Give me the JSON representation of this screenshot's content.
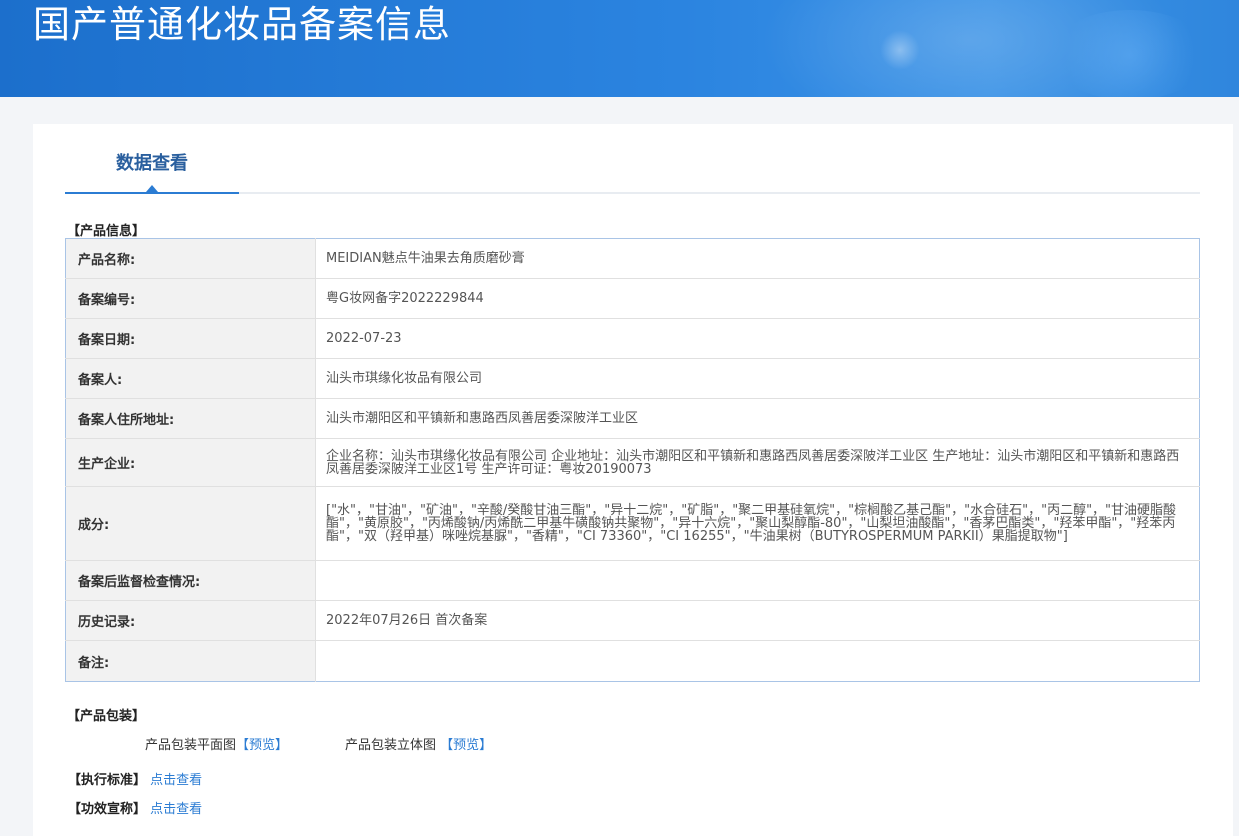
{
  "header": {
    "title": "国产普通化妆品备案信息"
  },
  "tabs": [
    {
      "label": "数据查看"
    }
  ],
  "product_info": {
    "section_title": "【产品信息】",
    "rows": [
      {
        "label": "产品名称:",
        "value": "MEIDIAN魅点牛油果去角质磨砂膏"
      },
      {
        "label": "备案编号:",
        "value": "粤G妆网备字2022229844"
      },
      {
        "label": "备案日期:",
        "value": "2022-07-23"
      },
      {
        "label": "备案人:",
        "value": "汕头市琪缘化妆品有限公司"
      },
      {
        "label": "备案人住所地址:",
        "value": "汕头市潮阳区和平镇新和惠路西凤善居委深陂洋工业区"
      },
      {
        "label": "生产企业:",
        "value": "企业名称：汕头市琪缘化妆品有限公司 企业地址：汕头市潮阳区和平镇新和惠路西凤善居委深陂洋工业区 生产地址：汕头市潮阳区和平镇新和惠路西凤善居委深陂洋工业区1号 生产许可证：粤妆20190073"
      },
      {
        "label": "成分:",
        "value": "[\"水\"，\"甘油\"，\"矿油\"，\"辛酸/癸酸甘油三酯\"，\"异十二烷\"，\"矿脂\"，\"聚二甲基硅氧烷\"，\"棕榈酸乙基己酯\"，\"水合硅石\"，\"丙二醇\"，\"甘油硬脂酸酯\"，\"黄原胶\"，\"丙烯酸钠/丙烯酰二甲基牛磺酸钠共聚物\"，\"异十六烷\"，\"聚山梨醇酯-80\"，\"山梨坦油酸酯\"，\"香茅巴酯类\"，\"羟苯甲酯\"，\"羟苯丙酯\"，\"双（羟甲基）咪唑烷基脲\"，\"香精\"，\"CI 73360\"，\"CI 16255\"，\"牛油果树（BUTYROSPERMUM PARKII）果脂提取物\"]"
      },
      {
        "label": "备案后监督检查情况:",
        "value": ""
      },
      {
        "label": "历史记录:",
        "value": "2022年07月26日 首次备案"
      },
      {
        "label": "备注:",
        "value": ""
      }
    ]
  },
  "packaging": {
    "section_title": "【产品包装】",
    "flat_label": "产品包装平面图",
    "flat_link": "【预览】",
    "three_d_label": "产品包装立体图",
    "three_d_link": "【预览】"
  },
  "standard": {
    "label": "【执行标准】",
    "link": "点击查看"
  },
  "efficacy": {
    "label": "【功效宣称】",
    "link": "点击查看"
  }
}
